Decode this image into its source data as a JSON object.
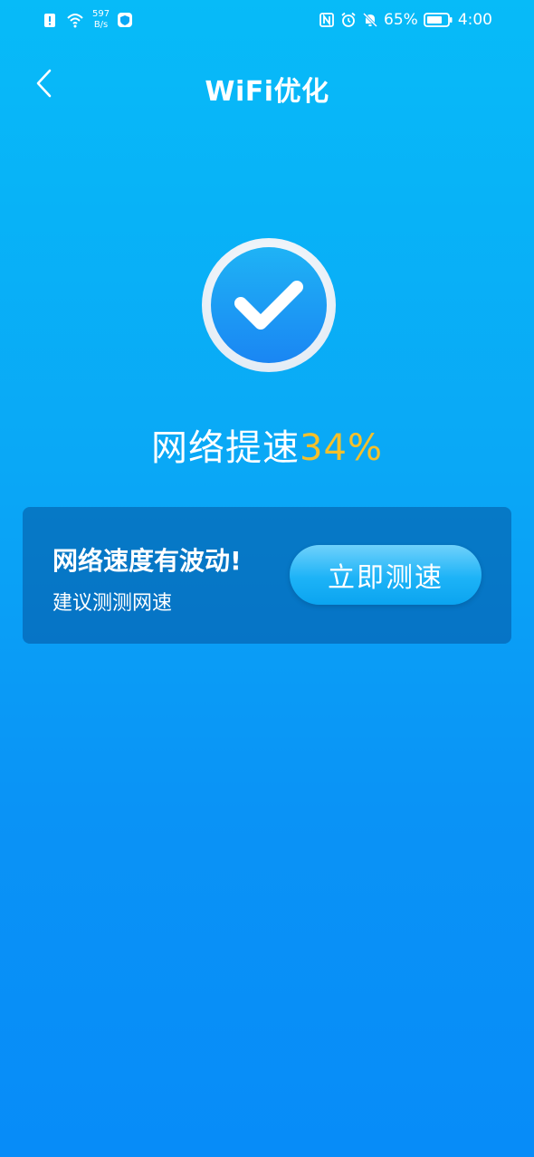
{
  "status_bar": {
    "net_speed_value": "597",
    "net_speed_unit": "B/s",
    "battery_percent": "65%",
    "time": "4:00"
  },
  "header": {
    "title": "WiFi优化"
  },
  "result": {
    "boost_label": "网络提速",
    "boost_percent": "34%"
  },
  "card": {
    "title": "网络速度有波动!",
    "subtitle": "建议测测网速",
    "button_label": "立即测速"
  },
  "colors": {
    "accent_yellow": "#f5c02a",
    "background_top": "#07bbf8",
    "background_bottom": "#078cf8"
  }
}
